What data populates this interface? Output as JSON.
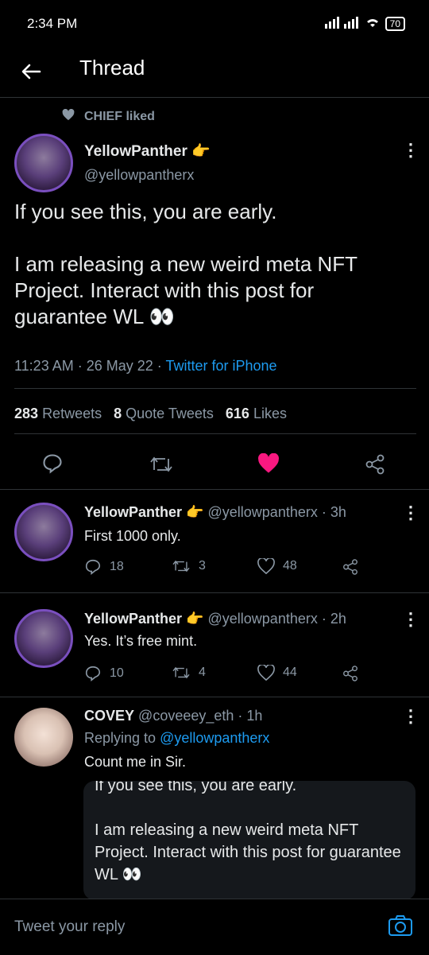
{
  "status": {
    "time": "2:34 PM",
    "battery": "70"
  },
  "header": {
    "title": "Thread"
  },
  "social_context": {
    "text": "CHIEF liked"
  },
  "main_tweet": {
    "name": "YellowPanther",
    "emoji": "👉",
    "handle": "@yellowpantherx",
    "text": "If you see this, you are early.\n\nI am releasing a new weird meta NFT Project. Interact with this post for guarantee WL 👀",
    "time": "11:23 AM · 26 May 22 · ",
    "source": "Twitter for iPhone",
    "retweets_count": "283",
    "retweets_label": "Retweets",
    "quotes_count": "8",
    "quotes_label": "Quote Tweets",
    "likes_count": "616",
    "likes_label": "Likes"
  },
  "replies": [
    {
      "name": "YellowPanther",
      "emoji": "👉",
      "meta": "@yellowpantherx · 3h",
      "text": "First 1000 only.",
      "reply_count": "18",
      "retweet_count": "3",
      "like_count": "48"
    },
    {
      "name": "YellowPanther",
      "emoji": "👉",
      "meta": "@yellowpantherx · 2h",
      "text": "Yes. It’s free mint.",
      "reply_count": "10",
      "retweet_count": "4",
      "like_count": "44"
    },
    {
      "name": "COVEY",
      "meta": "@coveeey_eth · 1h",
      "replying_prefix": "Replying to ",
      "replying_to": "@yellowpantherx",
      "text": "Count me in Sir.",
      "quote_text": "If you see this, you are early.\n\nI am releasing a new weird meta NFT Project. Interact with this post for guarantee WL 👀"
    }
  ],
  "composer": {
    "placeholder": "Tweet your reply"
  },
  "colors": {
    "like_pink": "#f91880",
    "link_blue": "#1d9bf0",
    "muted": "#8b98a5"
  }
}
